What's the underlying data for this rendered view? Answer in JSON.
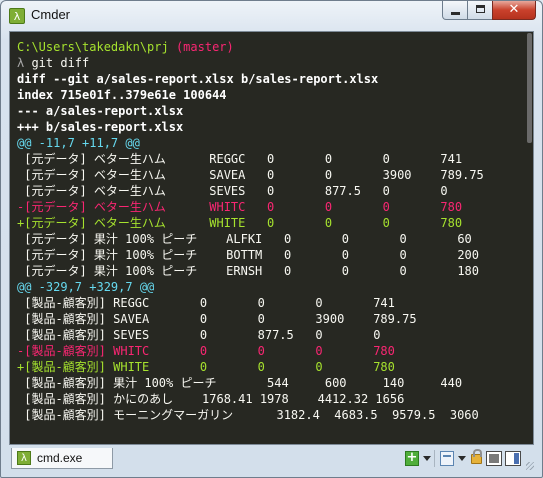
{
  "window": {
    "title": "Cmder",
    "app_icon_glyph": "λ",
    "close_glyph": "✕"
  },
  "console": {
    "lines": [
      [
        {
          "t": "C:\\Users\\takedakn\\prj ",
          "c": "path"
        },
        {
          "t": "(master)",
          "c": "branch"
        }
      ],
      [
        {
          "t": "λ ",
          "c": "prompt"
        },
        {
          "t": "git diff",
          "c": "white"
        }
      ],
      [
        {
          "t": "diff --git a/sales-report.xlsx b/sales-report.xlsx",
          "c": "bold"
        }
      ],
      [
        {
          "t": "index 715e01f..379e61e 100644",
          "c": "bold"
        }
      ],
      [
        {
          "t": "--- a/sales-report.xlsx",
          "c": "bold"
        }
      ],
      [
        {
          "t": "+++ b/sales-report.xlsx",
          "c": "bold"
        }
      ],
      [
        {
          "t": "@@ -11,7 +11,7 @@",
          "c": "cyan"
        }
      ],
      [
        {
          "t": " [元データ] ベター生ハム      REGGC   0       0       0       741",
          "c": "white"
        }
      ],
      [
        {
          "t": " [元データ] ベター生ハム      SAVEA   0       0       3900    789.75",
          "c": "white"
        }
      ],
      [
        {
          "t": " [元データ] ベター生ハム      SEVES   0       877.5   0       0",
          "c": "white"
        }
      ],
      [
        {
          "t": "-[元データ] ベター生ハム      WHITC   0       0       0       780",
          "c": "red"
        }
      ],
      [
        {
          "t": "+[元データ] ベター生ハム      WHITE   0       0       0       780",
          "c": "green"
        }
      ],
      [
        {
          "t": " [元データ] 果汁 100% ピーチ    ALFKI   0       0       0       60",
          "c": "white"
        }
      ],
      [
        {
          "t": " [元データ] 果汁 100% ピーチ    BOTTM   0       0       0       200",
          "c": "white"
        }
      ],
      [
        {
          "t": " [元データ] 果汁 100% ピーチ    ERNSH   0       0       0       180",
          "c": "white"
        }
      ],
      [
        {
          "t": "@@ -329,7 +329,7 @@",
          "c": "cyan"
        }
      ],
      [
        {
          "t": " [製品-顧客別] REGGC       0       0       0       741",
          "c": "white"
        }
      ],
      [
        {
          "t": " [製品-顧客別] SAVEA       0       0       3900    789.75",
          "c": "white"
        }
      ],
      [
        {
          "t": " [製品-顧客別] SEVES       0       877.5   0       0",
          "c": "white"
        }
      ],
      [
        {
          "t": "-[製品-顧客別] WHITC       0       0       0       780",
          "c": "red"
        }
      ],
      [
        {
          "t": "+[製品-顧客別] WHITE       0       0       0       780",
          "c": "green"
        }
      ],
      [
        {
          "t": " [製品-顧客別] 果汁 100% ピーチ       544     600     140     440",
          "c": "white"
        }
      ],
      [
        {
          "t": " [製品-顧客別] かにのあし    1768.41 1978    4412.32 1656",
          "c": "white"
        }
      ],
      [
        {
          "t": " [製品-顧客別] モーニングマーガリン      3182.4  4683.5  9579.5  3060",
          "c": "white"
        }
      ]
    ]
  },
  "statusbar": {
    "tab_label": "cmd.exe",
    "tab_icon_glyph": "λ",
    "new_console_glyph": "+"
  },
  "colors": {
    "console_bg": "#272822",
    "path": "#a6e22e",
    "branch": "#f92672",
    "hunk": "#66d9ef",
    "removed": "#f92672",
    "added": "#a6e22e"
  }
}
